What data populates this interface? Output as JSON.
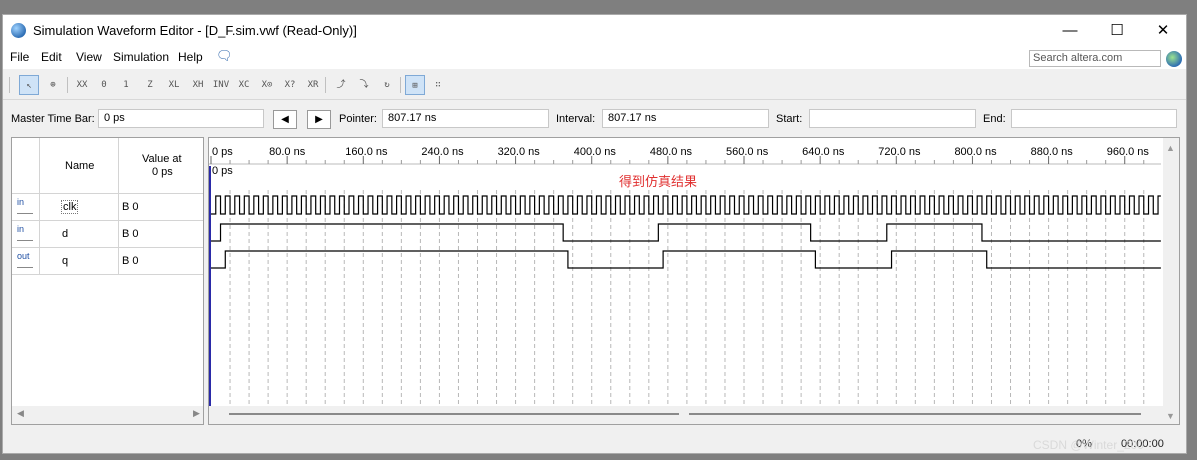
{
  "window": {
    "title": "Simulation Waveform Editor - [D_F.sim.vwf (Read-Only)]",
    "controls": [
      "—",
      "☐",
      "✕"
    ]
  },
  "menu": [
    "File",
    "Edit",
    "View",
    "Simulation",
    "Help"
  ],
  "search": {
    "placeholder": "Search altera.com"
  },
  "toolbar": [
    "select-tool-icon",
    "zoom-tool-icon",
    "uninitialized-value-icon",
    "forcing-low-icon",
    "forcing-high-icon",
    "high-impedance-icon",
    "weak-low-icon",
    "weak-high-icon",
    "invert-icon",
    "count-value-icon",
    "clock-value-icon",
    "arbitrary-value-icon",
    "random-value-icon",
    "run-functional-icon",
    "run-timing-icon",
    "generate-netlist-icon",
    "snap-to-grid-icon",
    "grid-settings-icon"
  ],
  "timebar": {
    "master_label": "Master Time Bar:",
    "master_value": "0 ps",
    "prev_btn": "◀",
    "next_btn": "▶",
    "pointer_label": "Pointer:",
    "pointer_value": "807.17 ns",
    "interval_label": "Interval:",
    "interval_value": "807.17 ns",
    "start_label": "Start:",
    "start_value": "",
    "end_label": "End:",
    "end_value": ""
  },
  "signal_table": {
    "name_header": "Name",
    "value_header_line1": "Value at",
    "value_header_line2": "0 ps",
    "rows": [
      {
        "pin": "in",
        "name": "clk",
        "value": "B 0"
      },
      {
        "pin": "in",
        "name": "d",
        "value": "B 0"
      },
      {
        "pin": "out",
        "name": "q",
        "value": "B 0"
      }
    ]
  },
  "timeline": {
    "ticks": [
      "0 ps",
      "80.0 ns",
      "160.0 ns",
      "240.0 ns",
      "320.0 ns",
      "400.0 ns",
      "480.0 ns",
      "560.0 ns",
      "640.0 ns",
      "720.0 ns",
      "800.0 ns",
      "880.0 ns",
      "960.0 ns"
    ],
    "marker_label": "0 ps",
    "annotation": "得到仿真结果",
    "annotation_color": "#e03030",
    "range_ns": [
      0,
      1000
    ],
    "clk_period_ns": 10,
    "d_transitions_ns": [
      10,
      370,
      470,
      630,
      710,
      810
    ],
    "q_transitions_ns": [
      15,
      375,
      475,
      635,
      715,
      815
    ]
  },
  "statusbar": {
    "percent": "0%",
    "time": "00:00:00",
    "watermark": "CSDN @Winter_200"
  }
}
